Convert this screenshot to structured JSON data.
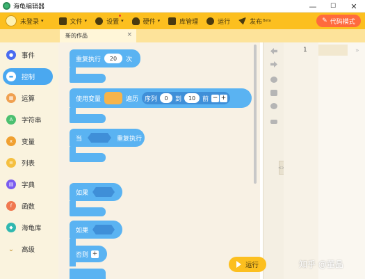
{
  "window": {
    "title": "海龟编辑器",
    "minimize": "—",
    "maximize": "☐",
    "close": "✕"
  },
  "toolbar": {
    "user": "未登录",
    "file": "文件",
    "settings": "设置",
    "hardware": "硬件",
    "library": "库管理",
    "run": "运行",
    "publish": "发布",
    "publish_suffix": "Beta",
    "code_mode": "代码模式"
  },
  "tab": {
    "label": "新的作品",
    "close": "×"
  },
  "sidebar": {
    "items": [
      {
        "label": "事件",
        "color": "#4a6cf0",
        "icon": "toggle-icon"
      },
      {
        "label": "控制",
        "color": "#4aa8f0",
        "icon": "gamepad-icon"
      },
      {
        "label": "运算",
        "color": "#f0a050",
        "icon": "grid-icon"
      },
      {
        "label": "字符串",
        "color": "#4cc070",
        "icon": "a-icon"
      },
      {
        "label": "变量",
        "color": "#f0a030",
        "icon": "x-icon"
      },
      {
        "label": "列表",
        "color": "#f5c040",
        "icon": "list-icon"
      },
      {
        "label": "字典",
        "color": "#7a5cf0",
        "icon": "book-icon"
      },
      {
        "label": "函数",
        "color": "#f07850",
        "icon": "fn-icon"
      },
      {
        "label": "海龟库",
        "color": "#30b8b0",
        "icon": "turtle-icon"
      },
      {
        "label": "高级",
        "color": "#c0902a",
        "icon": "chevron-down-icon"
      }
    ]
  },
  "blocks": {
    "repeat": {
      "label": "重复执行",
      "count": "20",
      "suffix": "次"
    },
    "foreach": {
      "label": "使用变量",
      "iter": "遍历",
      "range": "序列",
      "from": "0",
      "to_word": "到",
      "to": "10",
      "before": "前",
      "minus": "−",
      "plus": "+"
    },
    "while": {
      "label": "当",
      "suffix": "重复执行"
    },
    "if": {
      "label": "如果"
    },
    "ifelse": {
      "label": "如果",
      "else": "否则",
      "plus": "+"
    }
  },
  "editor": {
    "line": "1"
  },
  "run_button": "运行",
  "watermark": "知乎 @董晶",
  "colors": {
    "toolbar": "#fcbf1f",
    "block": "#5ab3f2",
    "code_mode": "#ff6a3d",
    "active_category": "#4aa8f0"
  }
}
